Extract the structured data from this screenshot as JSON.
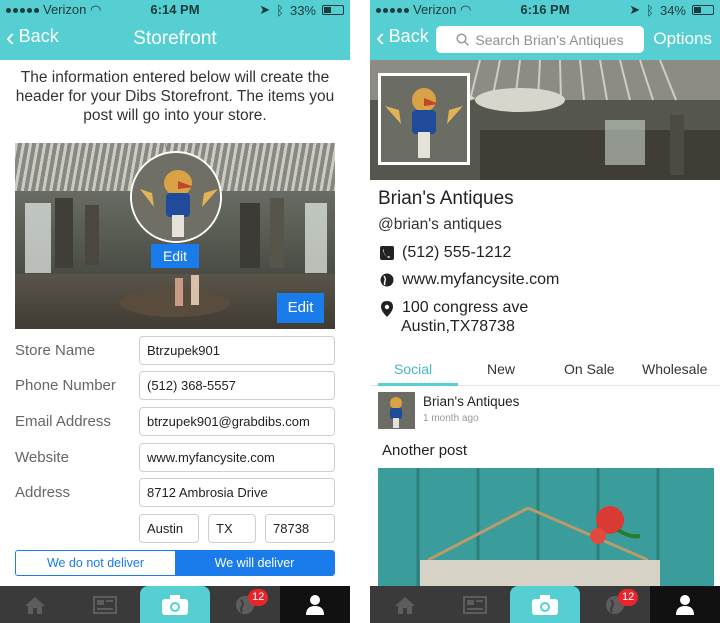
{
  "left_screen": {
    "status": {
      "carrier": "Verizon",
      "time": "6:14 PM",
      "battery": "33%",
      "battery_level": 0.33
    },
    "nav": {
      "back_label": "Back",
      "title": "Storefront"
    },
    "intro": "The information entered below will create the header for your Dibs Storefront. The items you post will go into your store.",
    "header_image": {
      "avatar_edit": "Edit",
      "cover_edit": "Edit"
    },
    "form": {
      "store_name": {
        "label": "Store Name",
        "value": "Btrzupek901"
      },
      "phone": {
        "label": "Phone Number",
        "value": "(512) 368-5557"
      },
      "email": {
        "label": "Email Address",
        "value": "btrzupek901@grabdibs.com"
      },
      "website": {
        "label": "Website",
        "value": "www.myfancysite.com"
      },
      "address": {
        "label": "Address",
        "value": "8712 Ambrosia Drive",
        "city": "Austin",
        "state": "TX",
        "zip": "78738"
      }
    },
    "delivery": {
      "off_label": "We do not deliver",
      "on_label": "We will deliver",
      "selected": "on"
    },
    "tabbar": {
      "badge": "12",
      "icons": [
        "home-icon",
        "news-icon",
        "camera-icon",
        "globe-icon",
        "profile-icon"
      ]
    }
  },
  "right_screen": {
    "status": {
      "carrier": "Verizon",
      "time": "6:16 PM",
      "battery": "34%",
      "battery_level": 0.34
    },
    "nav": {
      "back_label": "Back",
      "search_placeholder": "Search Brian's Antiques",
      "options_label": "Options"
    },
    "store": {
      "name": "Brian's Antiques",
      "handle": "@brian's antiques",
      "phone": "(512) 555-1212",
      "website": "www.myfancysite.com",
      "address_line1": "100 congress ave",
      "address_line2": "Austin,TX78738"
    },
    "tabs": [
      "Social",
      "New",
      "On Sale",
      "Wholesale"
    ],
    "active_tab": "Social",
    "post": {
      "author": "Brian's Antiques",
      "time": "1 month ago",
      "title": "Another post"
    },
    "tabbar": {
      "badge": "12"
    }
  },
  "colors": {
    "accent": "#55cfd2",
    "button_blue": "#1a7bea",
    "tabbar": "#3a3a3a",
    "badge": "#e8242c"
  }
}
